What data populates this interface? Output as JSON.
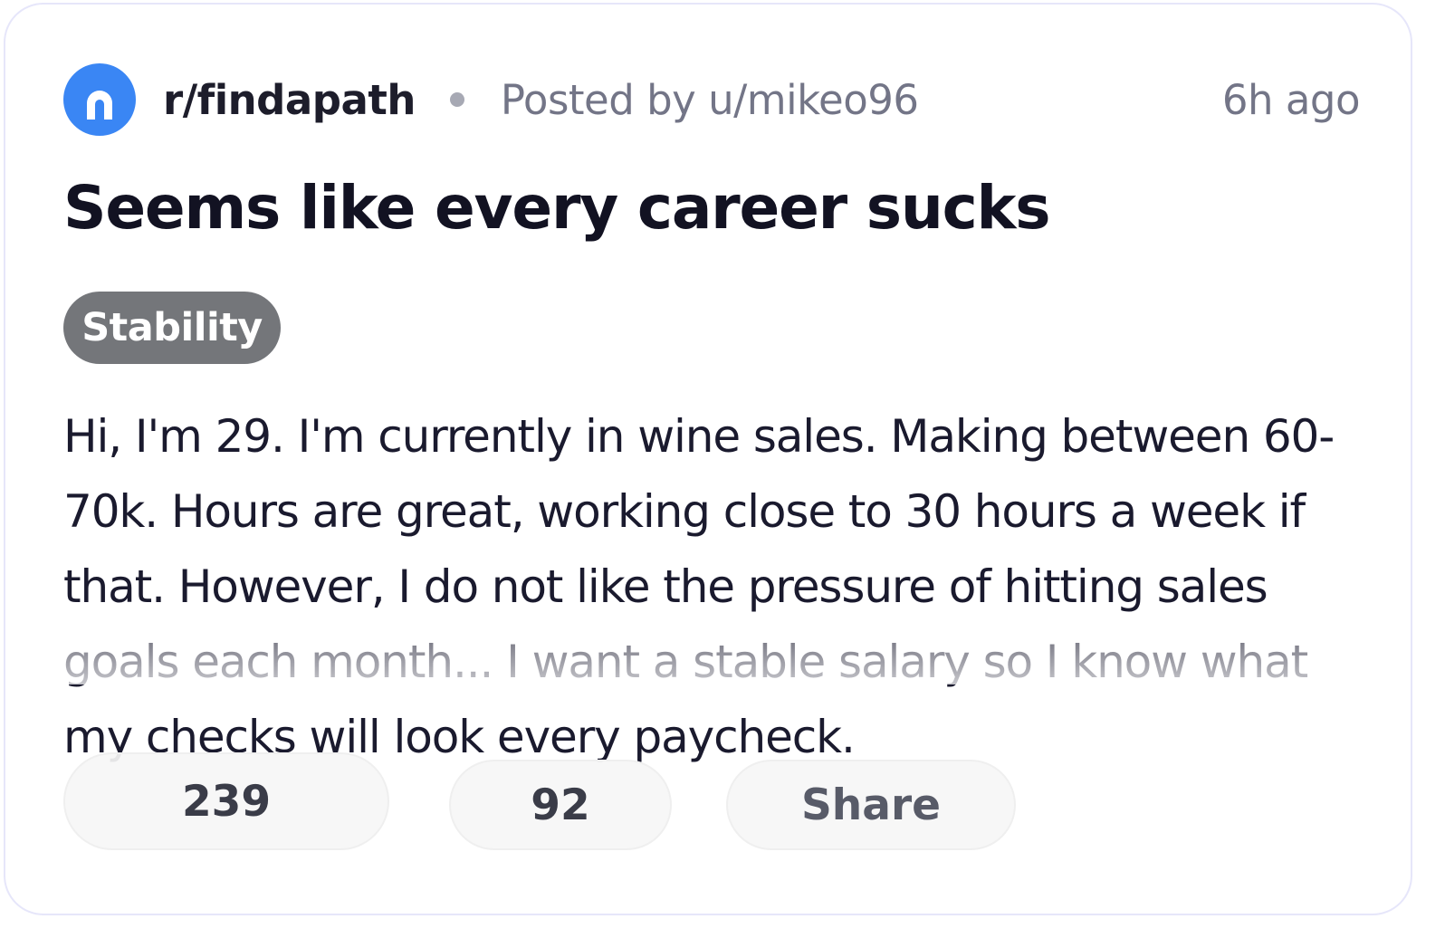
{
  "post": {
    "subreddit": "r/findapath",
    "posted_by": "Posted by u/mikeo96",
    "time_ago": "6h ago",
    "title": "Seems like every career sucks",
    "flair": "Stability",
    "body": "Hi, I'm 29. I'm currently in wine sales. Making between 60-70k. Hours are great, working close to 30 hours a week if that. However, I do not like the pressure of hitting sales goals each month... I want a stable salary so I know what my checks will look every paycheck."
  },
  "actions": {
    "upvotes": "239",
    "comments": "92",
    "share_label": "Share"
  },
  "colors": {
    "accent": "#3a86f4",
    "flair_bg": "#74767a"
  },
  "icons": {
    "subreddit_avatar": "subreddit-avatar-icon"
  }
}
